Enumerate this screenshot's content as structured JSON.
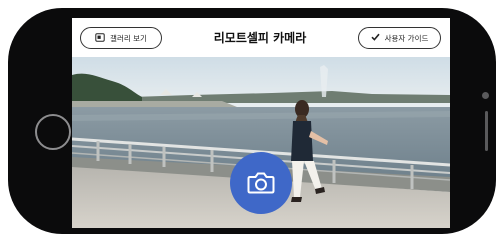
{
  "header": {
    "gallery_label": "갤러리 보기",
    "title": "리모트셀피 카메라",
    "guide_label": "사용자 가이드"
  },
  "colors": {
    "accent": "#3f68c8",
    "device": "#0b0b0c"
  },
  "icons": {
    "gallery": "gallery-icon",
    "guide": "checkmark-icon",
    "shutter": "camera-icon"
  }
}
